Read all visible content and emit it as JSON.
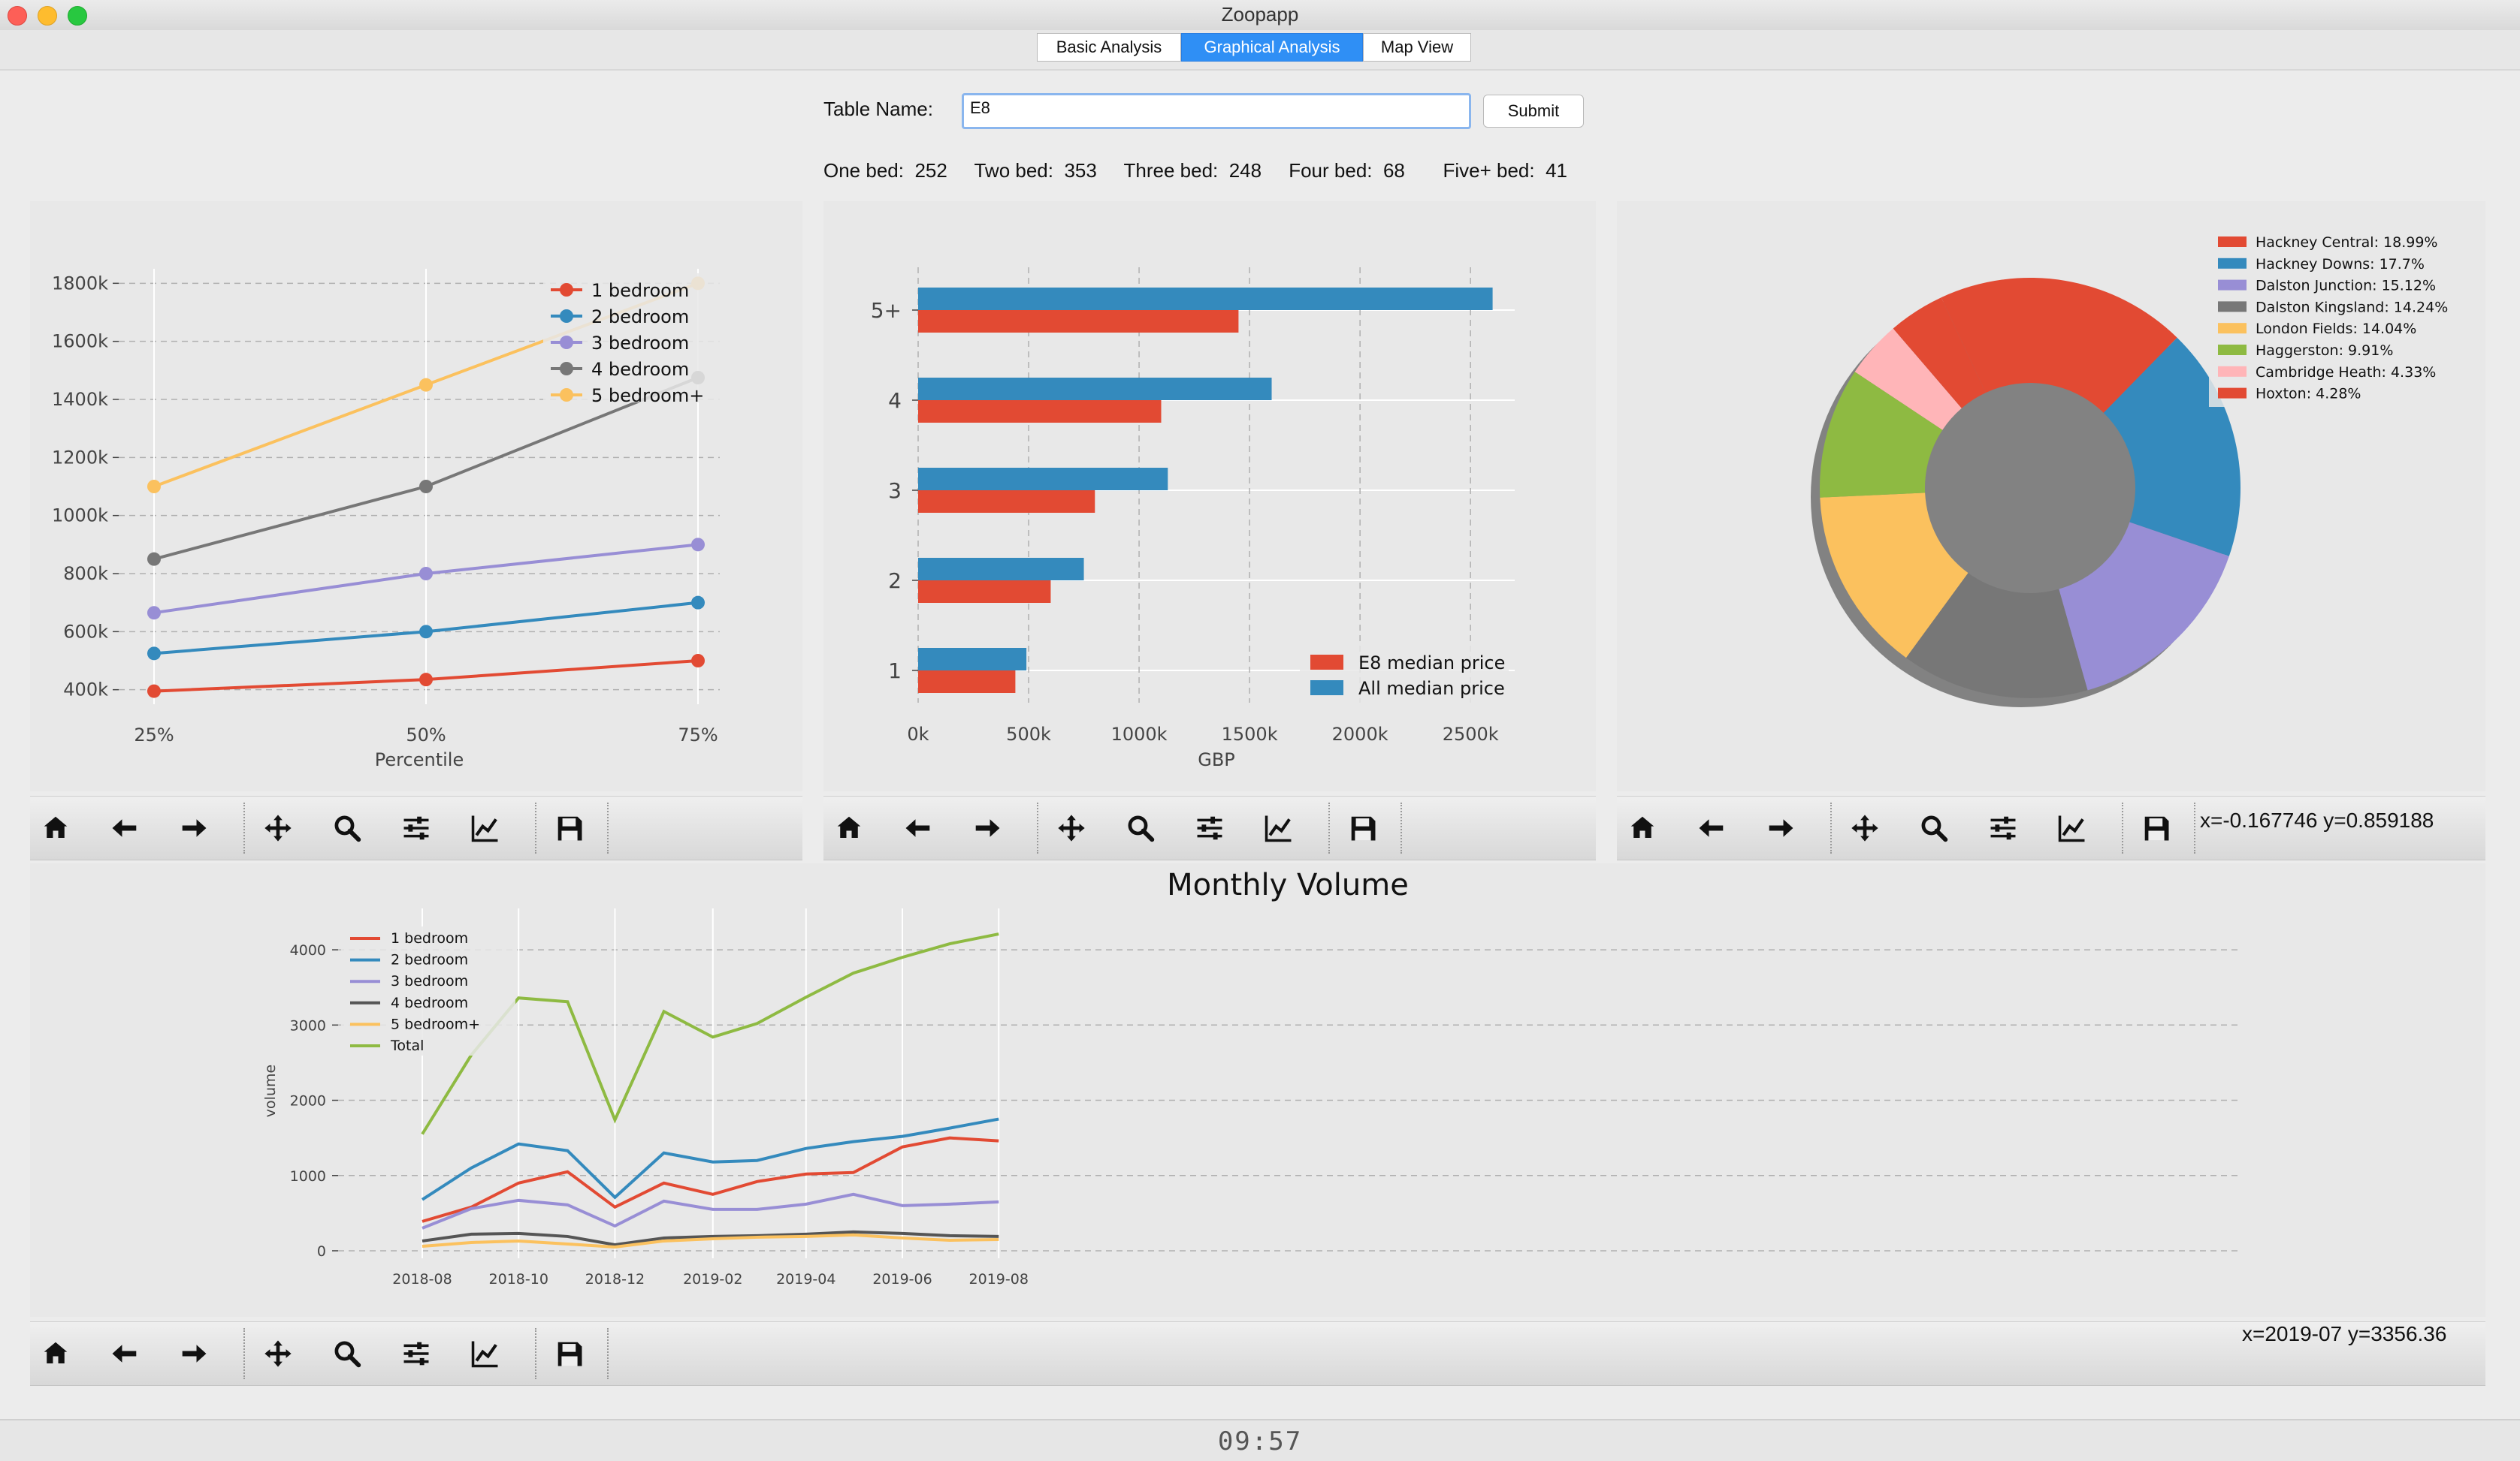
{
  "window": {
    "title": "Zoopapp"
  },
  "tabs": [
    "Basic Analysis",
    "Graphical Analysis",
    "Map View"
  ],
  "active_tab": "Graphical Analysis",
  "form": {
    "table_label": "Table Name:",
    "table_value": "E8",
    "submit_label": "Submit"
  },
  "counts": [
    {
      "label": "One bed:",
      "value": "252"
    },
    {
      "label": "Two bed:",
      "value": "353"
    },
    {
      "label": "Three bed:",
      "value": "248"
    },
    {
      "label": "Four bed:",
      "value": "68"
    },
    {
      "label": "Five+ bed:",
      "value": "41"
    }
  ],
  "toolbar_icons": [
    "home-icon",
    "back-arrow-icon",
    "forward-arrow-icon",
    "pan-icon",
    "zoom-icon",
    "configure-subplots-icon",
    "edit-axis-icon",
    "save-icon"
  ],
  "coords": {
    "pie": "x=-0.167746     y=0.859188",
    "volume": "x=2019-07 y=3356.36"
  },
  "clock": "09:57",
  "chart_data": [
    {
      "type": "line",
      "xlabel": "Percentile",
      "ylabel": "",
      "categories": [
        "25%",
        "50%",
        "75%"
      ],
      "yticks": [
        "400k",
        "600k",
        "800k",
        "1000k",
        "1200k",
        "1400k",
        "1600k",
        "1800k"
      ],
      "ylim": [
        350000,
        1850000
      ],
      "grid": true,
      "legend": "top-right",
      "series": [
        {
          "name": "1 bedroom",
          "color": "#e24a33",
          "values": [
            395000,
            435000,
            500000
          ]
        },
        {
          "name": "2 bedroom",
          "color": "#348abd",
          "values": [
            525000,
            600000,
            700000
          ]
        },
        {
          "name": "3 bedroom",
          "color": "#988ed5",
          "values": [
            665000,
            800000,
            900000
          ]
        },
        {
          "name": "4 bedroom",
          "color": "#777777",
          "values": [
            850000,
            1100000,
            1475000
          ]
        },
        {
          "name": "5 bedroom+",
          "color": "#fbc15e",
          "values": [
            1100000,
            1450000,
            1800000
          ]
        }
      ]
    },
    {
      "type": "bar",
      "orientation": "horizontal",
      "xlabel": "GBP",
      "categories": [
        "1",
        "2",
        "3",
        "4",
        "5+"
      ],
      "xticks": [
        "0k",
        "500k",
        "1000k",
        "1500k",
        "2000k",
        "2500k"
      ],
      "xlim": [
        0,
        2700000
      ],
      "grid": true,
      "legend": "bottom-right",
      "series": [
        {
          "name": "E8 median price",
          "color": "#e24a33",
          "values": [
            440000,
            600000,
            800000,
            1100000,
            1450000
          ]
        },
        {
          "name": "All median price",
          "color": "#348abd",
          "values": [
            490000,
            750000,
            1130000,
            1600000,
            2600000
          ]
        }
      ]
    },
    {
      "type": "pie",
      "donut": true,
      "legend": "top-right",
      "slices": [
        {
          "label": "Hackney Central: 18.99%",
          "value": 18.99,
          "color": "#e24a33"
        },
        {
          "label": "Hackney Downs: 17.7%",
          "value": 17.7,
          "color": "#348abd"
        },
        {
          "label": "Dalston Junction: 15.12%",
          "value": 15.12,
          "color": "#988ed5"
        },
        {
          "label": "Dalston Kingsland: 14.24%",
          "value": 14.24,
          "color": "#777777"
        },
        {
          "label": "London Fields: 14.04%",
          "value": 14.04,
          "color": "#fbc15e"
        },
        {
          "label": "Haggerston: 9.91%",
          "value": 9.91,
          "color": "#8eba42"
        },
        {
          "label": "Cambridge Heath: 4.33%",
          "value": 4.33,
          "color": "#ffb5b8"
        },
        {
          "label": "Hoxton: 4.28%",
          "value": 4.28,
          "color": "#e24a33"
        }
      ]
    },
    {
      "type": "line",
      "title": "Monthly Volume",
      "ylabel": "volume",
      "x": [
        "2018-08",
        "2018-09",
        "2018-10",
        "2018-11",
        "2018-12",
        "2019-01",
        "2019-02",
        "2019-03",
        "2019-04",
        "2019-05",
        "2019-06",
        "2019-07",
        "2019-08"
      ],
      "xticks": [
        "2018-08",
        "2018-10",
        "2018-12",
        "2019-02",
        "2019-04",
        "2019-06",
        "2019-08"
      ],
      "yticks": [
        "0",
        "1000",
        "2000",
        "3000",
        "4000"
      ],
      "ylim": [
        -100,
        4350
      ],
      "grid": true,
      "legend": "top-left",
      "series": [
        {
          "name": "1 bedroom",
          "color": "#e24a33",
          "values": [
            390,
            580,
            900,
            1050,
            580,
            900,
            750,
            920,
            1020,
            1040,
            1380,
            1500,
            1460
          ]
        },
        {
          "name": "2 bedroom",
          "color": "#348abd",
          "values": [
            680,
            1100,
            1420,
            1330,
            710,
            1300,
            1180,
            1200,
            1360,
            1450,
            1520,
            1630,
            1750
          ]
        },
        {
          "name": "3 bedroom",
          "color": "#988ed5",
          "values": [
            300,
            560,
            670,
            610,
            330,
            660,
            550,
            550,
            620,
            750,
            600,
            620,
            650
          ]
        },
        {
          "name": "4 bedroom",
          "color": "#555555",
          "values": [
            130,
            220,
            230,
            190,
            80,
            170,
            190,
            200,
            220,
            250,
            230,
            200,
            190
          ]
        },
        {
          "name": "5 bedroom+",
          "color": "#fbc15e",
          "values": [
            60,
            110,
            130,
            90,
            50,
            130,
            160,
            180,
            190,
            210,
            170,
            140,
            150
          ]
        },
        {
          "name": "Total",
          "color": "#8eba42",
          "values": [
            1550,
            2600,
            3360,
            3310,
            1740,
            3180,
            2840,
            3020,
            3370,
            3690,
            3900,
            4080,
            4210
          ]
        }
      ]
    }
  ]
}
